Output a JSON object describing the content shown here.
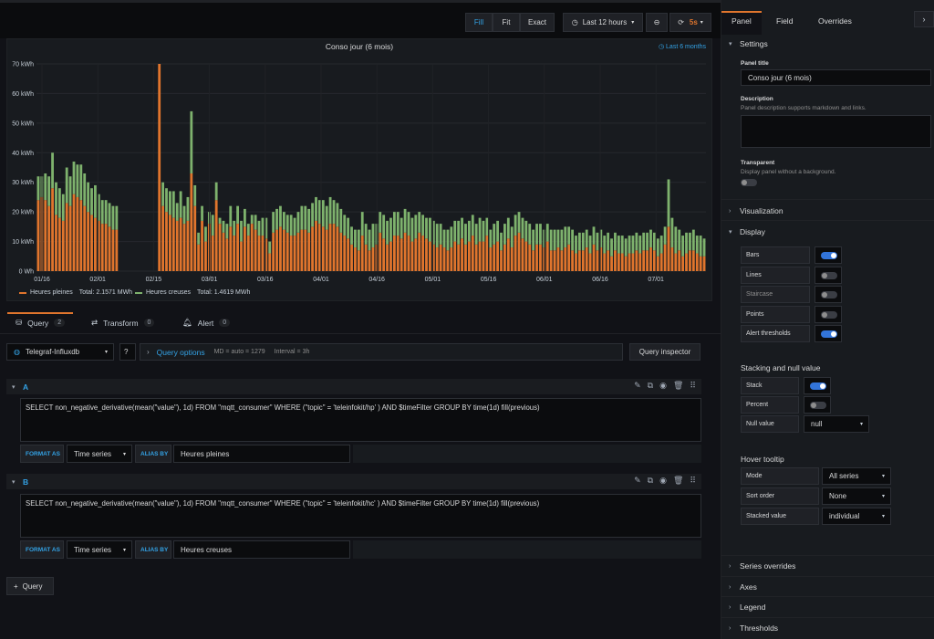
{
  "toolbar": {
    "fill": "Fill",
    "fit": "Fit",
    "exact": "Exact",
    "time_range": "Last 12 hours",
    "refresh": "5s"
  },
  "panel": {
    "title": "Conso jour (6 mois)",
    "range_badge": "Last 6 months",
    "legend": [
      {
        "name": "Heures pleines",
        "total": "Total: 2.1571 MWh",
        "color": "#e0752d"
      },
      {
        "name": "Heures creuses",
        "total": "Total: 1.4619 MWh",
        "color": "#7eb26d"
      }
    ]
  },
  "chart_data": {
    "type": "bar",
    "stacked": true,
    "ylim": [
      0,
      70
    ],
    "yticks": [
      "0 Wh",
      "10 kWh",
      "20 kWh",
      "30 kWh",
      "40 kWh",
      "50 kWh",
      "60 kWh",
      "70 kWh"
    ],
    "xticks": [
      "01/16",
      "02/01",
      "02/15",
      "03/01",
      "03/16",
      "04/01",
      "04/16",
      "05/01",
      "05/16",
      "06/01",
      "06/16",
      "07/01"
    ],
    "series": [
      {
        "name": "Heures pleines",
        "color": "#e0752d",
        "values": [
          24,
          25,
          24,
          22,
          28,
          19,
          18,
          17,
          23,
          22,
          26,
          25,
          24,
          22,
          20,
          19,
          18,
          17,
          16,
          16,
          15,
          14,
          14,
          0,
          0,
          0,
          0,
          0,
          0,
          0,
          0,
          0,
          0,
          0,
          70,
          22,
          20,
          19,
          18,
          17,
          18,
          16,
          17,
          33,
          22,
          9,
          17,
          10,
          16,
          12,
          24,
          16,
          13,
          11,
          15,
          12,
          16,
          10,
          15,
          12,
          16,
          14,
          12,
          12,
          11,
          6,
          13,
          14,
          15,
          14,
          13,
          12,
          12,
          13,
          14,
          14,
          13,
          15,
          17,
          16,
          15,
          14,
          16,
          16,
          15,
          13,
          12,
          11,
          9,
          8,
          7,
          12,
          9,
          7,
          8,
          9,
          13,
          11,
          9,
          10,
          12,
          12,
          11,
          13,
          12,
          10,
          11,
          13,
          12,
          11,
          10,
          9,
          8,
          9,
          8,
          7,
          8,
          10,
          9,
          11,
          9,
          10,
          12,
          9,
          10,
          10,
          12,
          8,
          9,
          10,
          7,
          9,
          11,
          8,
          12,
          13,
          11,
          10,
          9,
          7,
          9,
          9,
          8,
          10,
          7,
          7,
          8,
          7,
          8,
          9,
          7,
          6,
          7,
          7,
          8,
          6,
          9,
          7,
          8,
          6,
          7,
          5,
          7,
          6,
          6,
          5,
          6,
          6,
          7,
          6,
          7,
          7,
          8,
          7,
          5,
          6,
          9,
          15,
          8,
          6,
          7,
          5,
          6,
          7,
          7,
          6,
          5,
          5
        ],
        "values_cr": []
      },
      {
        "name": "Heures creuses",
        "color": "#7eb26d",
        "values": [
          8,
          7,
          9,
          10,
          12,
          11,
          10,
          9,
          12,
          10,
          11,
          11,
          12,
          11,
          10,
          9,
          11,
          9,
          8,
          8,
          8,
          8,
          8,
          0,
          0,
          0,
          0,
          0,
          0,
          0,
          0,
          0,
          0,
          0,
          0,
          8,
          8,
          8,
          9,
          6,
          9,
          6,
          8,
          21,
          7,
          4,
          5,
          5,
          4,
          7,
          6,
          2,
          4,
          5,
          7,
          5,
          6,
          7,
          6,
          4,
          3,
          5,
          5,
          6,
          7,
          4,
          7,
          7,
          7,
          6,
          6,
          7,
          6,
          7,
          8,
          8,
          8,
          8,
          8,
          8,
          9,
          8,
          9,
          8,
          8,
          8,
          7,
          7,
          6,
          6,
          7,
          8,
          7,
          7,
          8,
          7,
          7,
          8,
          8,
          8,
          8,
          8,
          7,
          8,
          8,
          8,
          8,
          7,
          7,
          7,
          8,
          8,
          8,
          7,
          6,
          7,
          7,
          7,
          8,
          7,
          7,
          7,
          7,
          7,
          8,
          7,
          6,
          6,
          7,
          7,
          6,
          7,
          7,
          7,
          7,
          7,
          7,
          7,
          7,
          7,
          7,
          7,
          6,
          6,
          7,
          7,
          6,
          7,
          7,
          6,
          7,
          6,
          6,
          6,
          6,
          6,
          6,
          6,
          6,
          6,
          6,
          6,
          6,
          6,
          6,
          6,
          6,
          6,
          6,
          6,
          6,
          6,
          6,
          6,
          6,
          6,
          6,
          16,
          10,
          9,
          7,
          7,
          7,
          6,
          7,
          6,
          7,
          6
        ]
      }
    ]
  },
  "query_tabs": [
    {
      "label": "Query",
      "count": "2"
    },
    {
      "label": "Transform",
      "count": "0"
    },
    {
      "label": "Alert",
      "count": "0"
    }
  ],
  "datasource": "Telegraf-Influxdb",
  "query_options": {
    "label": "Query options",
    "md": "MD = auto = 1279",
    "interval": "Interval = 3h"
  },
  "query_inspector": "Query inspector",
  "queries": [
    {
      "letter": "A",
      "sql": "SELECT non_negative_derivative(mean(\"value\"), 1d) FROM \"mqtt_consumer\" WHERE (\"topic\" = 'teleinfokit/hp' ) AND $timeFilter GROUP BY time(1d) fill(previous)",
      "format_label": "FORMAT AS",
      "format_value": "Time series",
      "alias_label": "ALIAS BY",
      "alias_value": "Heures pleines"
    },
    {
      "letter": "B",
      "sql": "SELECT non_negative_derivative(mean(\"value\"), 1d) FROM \"mqtt_consumer\" WHERE (\"topic\" = 'teleinfokit/hc' ) AND $timeFilter GROUP BY time(1d) fill(previous)",
      "format_label": "FORMAT AS",
      "format_value": "Time series",
      "alias_label": "ALIAS BY",
      "alias_value": "Heures creuses"
    }
  ],
  "add_query": "Query",
  "side": {
    "tabs": [
      "Panel",
      "Field",
      "Overrides"
    ],
    "settings": "Settings",
    "panel_title_label": "Panel title",
    "panel_title_value": "Conso jour (6 mois)",
    "description_label": "Description",
    "description_hint": "Panel description supports markdown and links.",
    "transparent_label": "Transparent",
    "transparent_hint": "Display panel without a background.",
    "visualization": "Visualization",
    "display": "Display",
    "display_opts": [
      {
        "label": "Bars",
        "on": true
      },
      {
        "label": "Lines",
        "on": false
      },
      {
        "label": "Staircase",
        "on": false
      },
      {
        "label": "Points",
        "on": false
      },
      {
        "label": "Alert thresholds",
        "on": true
      }
    ],
    "stacking_header": "Stacking and null value",
    "stack_label": "Stack",
    "percent_label": "Percent",
    "null_label": "Null value",
    "null_value": "null",
    "hover_header": "Hover tooltip",
    "mode_label": "Mode",
    "mode_value": "All series",
    "sort_label": "Sort order",
    "sort_value": "None",
    "stacked_label": "Stacked value",
    "stacked_value": "individual",
    "bottom_sections": [
      "Series overrides",
      "Axes",
      "Legend",
      "Thresholds"
    ]
  }
}
